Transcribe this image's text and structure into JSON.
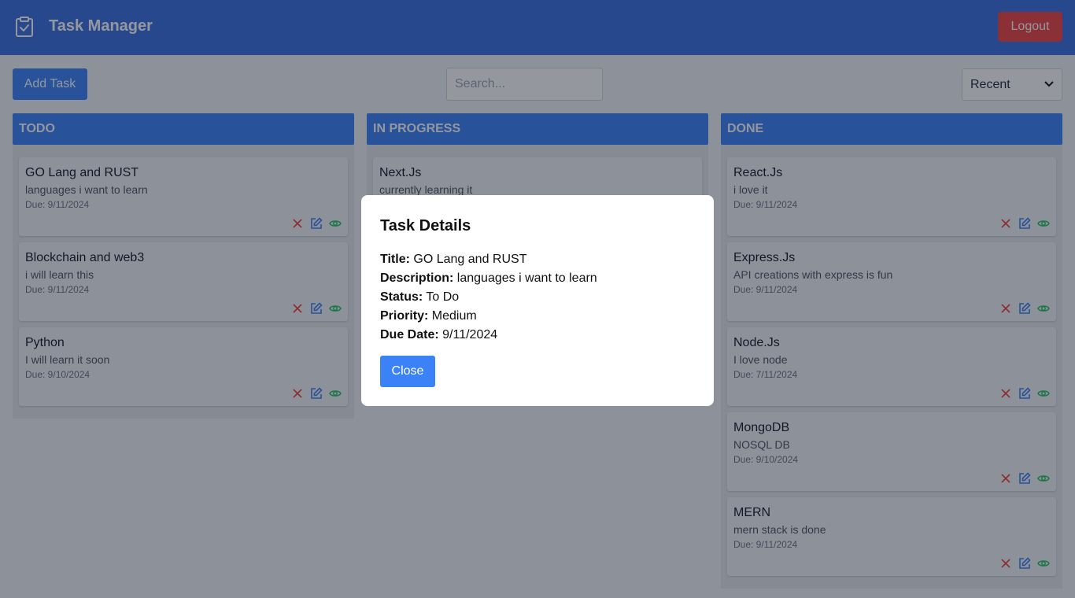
{
  "header": {
    "title": "Task Manager",
    "logout_label": "Logout",
    "icon": "clipboard-check-icon"
  },
  "toolbar": {
    "add_label": "Add Task",
    "search_placeholder": "Search...",
    "sort_selected": "Recent"
  },
  "colors": {
    "header": "#3b6fe0",
    "primary": "#3b82f6",
    "danger": "#ef4444",
    "edit": "#3b82f6",
    "view": "#22c55e"
  },
  "columns": [
    {
      "title": "TODO",
      "cards": [
        {
          "title": "GO Lang and RUST",
          "desc": "languages i want to learn",
          "due": "Due: 9/11/2024"
        },
        {
          "title": "Blockchain and web3",
          "desc": "i will learn this",
          "due": "Due: 9/11/2024"
        },
        {
          "title": "Python",
          "desc": "I will learn it soon",
          "due": "Due: 9/10/2024"
        }
      ]
    },
    {
      "title": "IN PROGRESS",
      "cards": [
        {
          "title": "Next.Js",
          "desc": "currently learning it",
          "due": ""
        }
      ]
    },
    {
      "title": "DONE",
      "cards": [
        {
          "title": "React.Js",
          "desc": "i love it",
          "due": "Due: 9/11/2024"
        },
        {
          "title": "Express.Js",
          "desc": "API creations with express is fun",
          "due": "Due: 9/11/2024"
        },
        {
          "title": "Node.Js",
          "desc": "I love node",
          "due": "Due: 7/11/2024"
        },
        {
          "title": "MongoDB",
          "desc": "NOSQL DB",
          "due": "Due: 9/10/2024"
        },
        {
          "title": "MERN",
          "desc": "mern stack is done",
          "due": "Due: 9/11/2024"
        }
      ]
    }
  ],
  "modal": {
    "title": "Task Details",
    "title_label": "Title:",
    "title_value": "GO Lang and RUST",
    "desc_label": "Description:",
    "desc_value": "languages i want to learn",
    "status_label": "Status:",
    "status_value": "To Do",
    "priority_label": "Priority:",
    "priority_value": "Medium",
    "due_label": "Due Date:",
    "due_value": "9/11/2024",
    "close_label": "Close"
  }
}
